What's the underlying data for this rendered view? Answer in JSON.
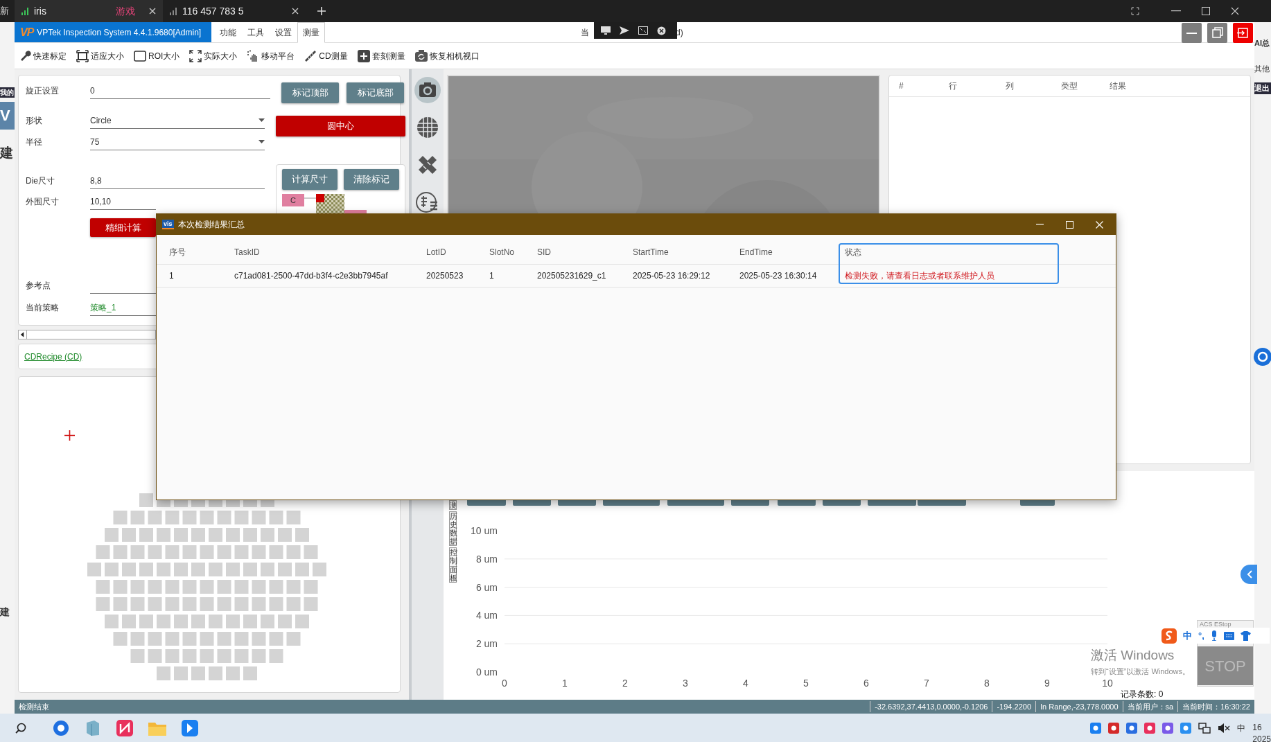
{
  "desktop": {
    "left_texts": [
      "新",
      "我的",
      "V",
      "建",
      "建"
    ],
    "right_texts": [
      "AI总",
      "其他",
      "退出"
    ]
  },
  "browser_tabs": [
    {
      "label": "iris",
      "badge": "游戏",
      "selected": true
    },
    {
      "label": "116 457 783 5",
      "selected": false
    }
  ],
  "app": {
    "logo": "VP",
    "title": "VPTek Inspection System 4.4.1.9680[Admin]",
    "caption_left": "当",
    "caption_right": "d)",
    "menu": [
      {
        "label": "功能",
        "selected": false
      },
      {
        "label": "工具",
        "selected": false
      },
      {
        "label": "设置",
        "selected": false
      },
      {
        "label": "测量",
        "selected": true
      }
    ]
  },
  "toolbar": [
    "快速标定",
    "适应大小",
    "ROI大小",
    "实际大小",
    "移动平台",
    "CD测量",
    "套刻测量",
    "恢复相机视口"
  ],
  "form": {
    "fields": [
      {
        "label": "旋正设置",
        "value": "0",
        "kind": "text"
      },
      {
        "label": "形状",
        "value": "Circle",
        "kind": "dropdown"
      },
      {
        "label": "半径",
        "value": "75",
        "kind": "dropdown"
      },
      {
        "label": "Die尺寸",
        "value": "8,8",
        "kind": "text"
      },
      {
        "label": "外围尺寸",
        "value": "10,10",
        "kind": "text"
      },
      {
        "label": "参考点",
        "kind": "text"
      },
      {
        "label": "当前策略",
        "value": "策略_1",
        "kind": "link"
      }
    ],
    "mark_buttons": [
      {
        "label": "标记顶部",
        "kind": "muted"
      },
      {
        "label": "标记底部",
        "kind": "muted"
      }
    ],
    "center_button": {
      "label": "圆中心",
      "kind": "danger"
    },
    "size_buttons": [
      {
        "label": "计算尺寸",
        "kind": "muted"
      },
      {
        "label": "清除标记",
        "kind": "muted"
      }
    ],
    "layout_marker": "C",
    "calc_button": {
      "label": "精细计算",
      "kind": "danger"
    }
  },
  "recipe": {
    "link": "CDRecipe (CD)"
  },
  "results_table": {
    "columns": [
      "#",
      "行",
      "列",
      "类型",
      "结果"
    ]
  },
  "side_tools": [
    {
      "selected": true
    },
    {
      "selected": false
    },
    {
      "selected": false
    },
    {
      "selected": false
    }
  ],
  "chart_panel": {
    "side_tabs": [
      "测",
      "历史数据",
      "控制面板"
    ],
    "record_count": "记录条数: 0",
    "chart_data": {
      "type": "line",
      "grid": true,
      "xlim": [
        0,
        10
      ],
      "ylim": [
        0,
        10
      ],
      "xticks": [
        0,
        1,
        2,
        3,
        4,
        5,
        6,
        7,
        8,
        9,
        10
      ],
      "yticks": [
        {
          "value": 0,
          "label": "0 um"
        },
        {
          "value": 2,
          "label": "2 um"
        },
        {
          "value": 4,
          "label": "4 um"
        },
        {
          "value": 6,
          "label": "6 um"
        },
        {
          "value": 8,
          "label": "8 um"
        },
        {
          "value": 10,
          "label": "10 um"
        }
      ]
    }
  },
  "status_bar": [
    "检测结束",
    "-32.6392,37.4413,0.0000,-0.1206",
    "-194.2200",
    "In Range,-23,778.0000",
    "当前用户：sa",
    "当前时间：16:30:22"
  ],
  "dialog": {
    "icon_text": "vis",
    "title": "本次检测结果汇总",
    "columns": [
      "序号",
      "TaskID",
      "LotID",
      "SlotNo",
      "SID",
      "StartTime",
      "EndTime",
      "状态"
    ],
    "rows": [
      {
        "cells": [
          "1",
          "c71ad081-2500-47dd-b3f4-c2e3bb7945af",
          "20250523",
          "1",
          "202505231629_c1",
          "2025-05-23 16:29:12",
          "2025-05-23 16:30:14",
          "检测失败，请查看日志或者联系维护人员"
        ],
        "error": true,
        "focused": true
      }
    ]
  },
  "estop": {
    "title": "ACS EStop",
    "button": "STOP"
  },
  "ime_bar": {
    "mode": "中",
    "punct": "°,"
  },
  "activation": {
    "title": "激活 Windows",
    "hint": "转到“设置”以激活 Windows。"
  },
  "taskbar": {
    "ime": "中",
    "clock": [
      "16",
      "2025"
    ]
  }
}
